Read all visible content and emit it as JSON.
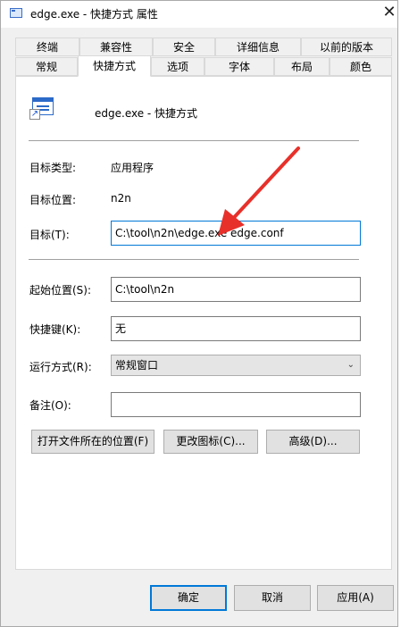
{
  "window": {
    "title": "edge.exe - 快捷方式 属性",
    "close_glyph": "✕"
  },
  "tabs_row1": [
    "终端",
    "兼容性",
    "安全",
    "详细信息",
    "以前的版本"
  ],
  "tabs_row2": [
    "常规",
    "快捷方式",
    "选项",
    "字体",
    "布局",
    "颜色"
  ],
  "active_tab": "快捷方式",
  "shortcut": {
    "name": "edge.exe - 快捷方式",
    "target_type_label": "目标类型:",
    "target_type": "应用程序",
    "target_location_label": "目标位置:",
    "target_location": "n2n",
    "target_label": "目标(T):",
    "target": "C:\\tool\\n2n\\edge.exe edge.conf",
    "start_in_label": "起始位置(S):",
    "start_in": "C:\\tool\\n2n",
    "hotkey_label": "快捷键(K):",
    "hotkey": "无",
    "run_label": "运行方式(R):",
    "run": "常规窗口",
    "comment_label": "备注(O):",
    "comment": ""
  },
  "buttons": {
    "open_location": "打开文件所在的位置(F)",
    "change_icon": "更改图标(C)...",
    "advanced": "高级(D)...",
    "ok": "确定",
    "cancel": "取消",
    "apply": "应用(A)"
  },
  "annotation_color": "#e8302a",
  "accent": "#0078d7"
}
